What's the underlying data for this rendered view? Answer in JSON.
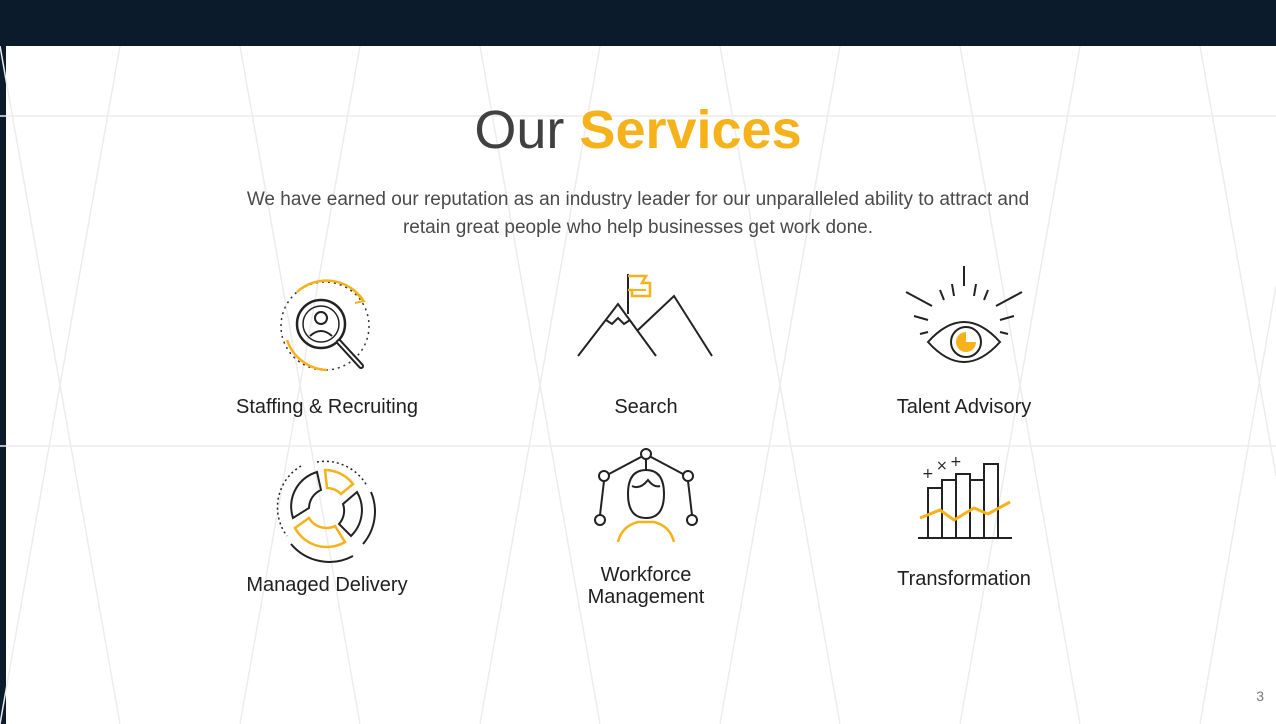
{
  "title": {
    "prefix": "Our",
    "highlight": "Services"
  },
  "subtitle": "We have earned our reputation as an industry leader for our unparalleled ability to attract and retain great people who help businesses get work done.",
  "colors": {
    "accent": "#f5b21a",
    "dark": "#0c1b2c",
    "text": "#404040"
  },
  "services": [
    {
      "label": "Staffing & Recruiting",
      "icon": "magnifier-person-icon"
    },
    {
      "label": "Search",
      "icon": "mountain-flag-icon"
    },
    {
      "label": "Talent Advisory",
      "icon": "eye-icon"
    },
    {
      "label": "Managed Delivery",
      "icon": "segmented-cycle-icon"
    },
    {
      "label_line1": "Workforce",
      "label_line2": "Management",
      "icon": "network-person-icon"
    },
    {
      "label": "Transformation",
      "icon": "growth-chart-icon"
    }
  ],
  "page_number": "3"
}
